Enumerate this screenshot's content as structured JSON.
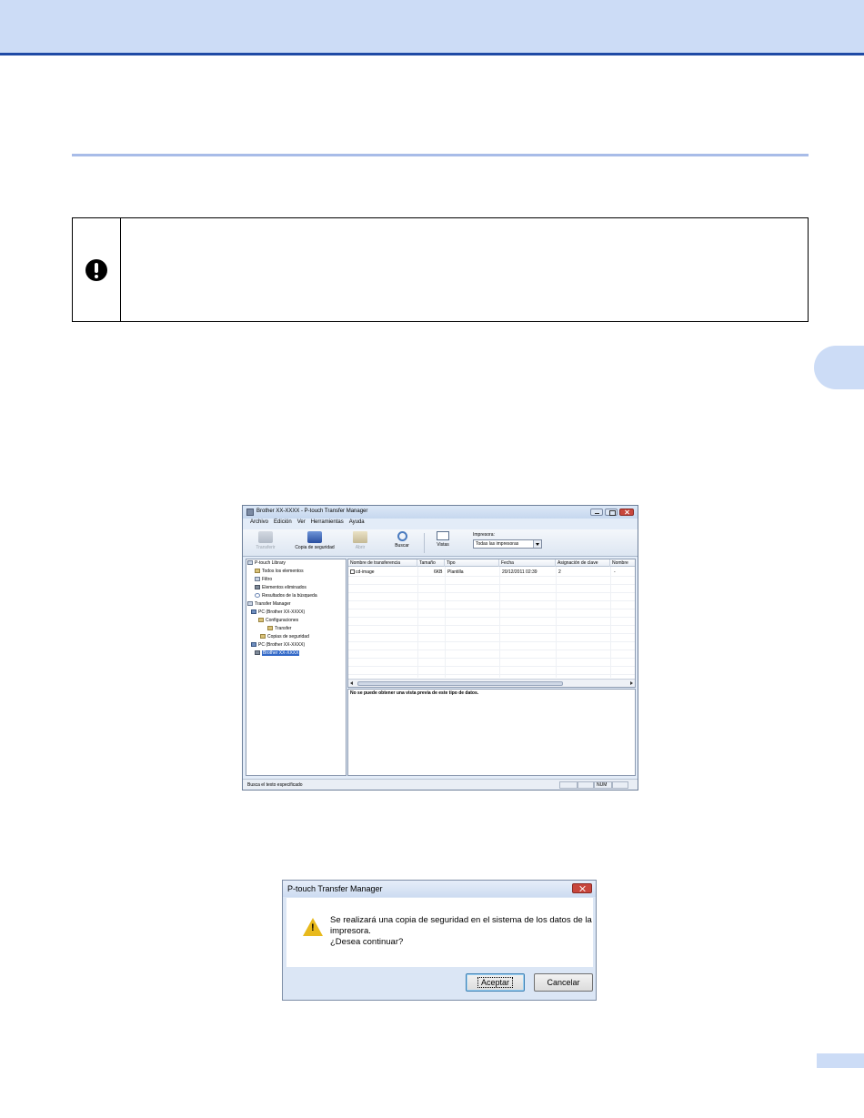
{
  "app_window": {
    "title": "Brother XX-XXXX - P-touch Transfer Manager",
    "menu": [
      "Archivo",
      "Edición",
      "Ver",
      "Herramientas",
      "Ayuda"
    ],
    "toolbar": {
      "transfer": "Transferir",
      "backup": "Copia de seguridad",
      "open": "Abrir",
      "search": "Buscar",
      "views": "Vistas",
      "printer_label": "Impresora:",
      "printer_value": "Todas las impresoras"
    },
    "tree": [
      {
        "label": "P-touch Library",
        "icon": "library-icon"
      },
      {
        "label": "Todos los elementos",
        "icon": "folder-icon"
      },
      {
        "label": "Filtro",
        "icon": "filter-icon"
      },
      {
        "label": "Elementos eliminados",
        "icon": "trash-icon"
      },
      {
        "label": "Resultados de la búsqueda",
        "icon": "search-icon"
      },
      {
        "label": "Transfer Manager",
        "icon": "transfer-manager-icon"
      },
      {
        "label": "PC (Brother XX-XXXX)",
        "icon": "pc-icon"
      },
      {
        "label": "Configuraciones",
        "icon": "settings-folder-icon"
      },
      {
        "label": "Transfer",
        "icon": "folder-icon"
      },
      {
        "label": "Copias de seguridad",
        "icon": "backup-folder-icon"
      },
      {
        "label": "PC (Brother XX-XXXX)",
        "icon": "pc-icon"
      },
      {
        "label": "Brother XX-XXXX",
        "icon": "printer-icon"
      }
    ],
    "list": {
      "columns": [
        "Nombre de transferencia",
        "Tamaño",
        "Tipo",
        "Fecha",
        "Asignación de clave",
        "Nombre"
      ],
      "rows": [
        [
          "cd-image",
          "6KB",
          "Plantilla",
          "20/12/2011 02:39",
          "2",
          "-"
        ]
      ]
    },
    "preview_message": "No se puede obtener una vista previa de este tipo de datos.",
    "status": {
      "text": "Busca el texto especificado",
      "num": "NUM"
    }
  },
  "dialog": {
    "title": "P-touch Transfer Manager",
    "message_line1": "Se realizará una copia de seguridad en el sistema de los datos de la",
    "message_line2": "impresora.",
    "message_line3": "¿Desea continuar?",
    "ok": "Aceptar",
    "cancel": "Cancelar"
  }
}
